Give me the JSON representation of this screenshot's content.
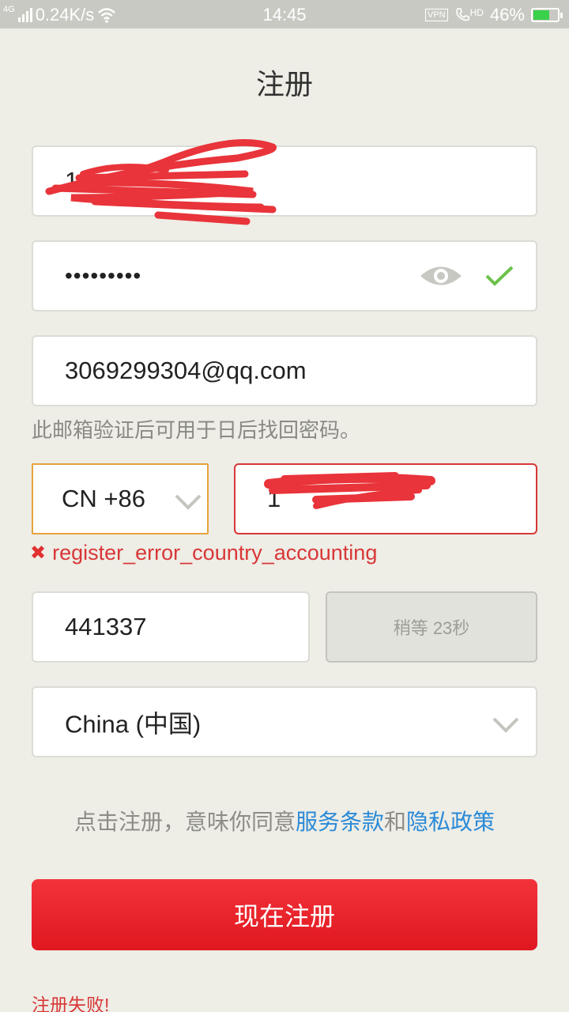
{
  "status_bar": {
    "network_type": "4G",
    "speed": "0.24K/s",
    "time": "14:45",
    "vpn": "VPN",
    "hd": "HD",
    "battery": "46%",
    "battery_level": 0.46,
    "icons": [
      "signal-icon",
      "wifi-icon",
      "vpn-icon",
      "call-hd-icon",
      "battery-icon"
    ]
  },
  "page": {
    "title": "注册"
  },
  "form": {
    "username": {
      "value": "13"
    },
    "password": {
      "value": "•••••••••",
      "valid": true
    },
    "email": {
      "value": "3069299304@qq.com",
      "hint": "此邮箱验证后可用于日后找回密码。"
    },
    "country_code": {
      "value": "CN +86"
    },
    "phone": {
      "value": "1"
    },
    "phone_error": "register_error_country_accounting",
    "verification_code": {
      "value": "441337"
    },
    "resend_button": "稍等 23秒",
    "region": {
      "value": "China (中国)"
    }
  },
  "agreement": {
    "prefix": "点击注册，意味你同意",
    "terms": "服务条款",
    "conjunction": "和",
    "privacy": "隐私政策"
  },
  "submit_button": "现在注册",
  "failure_message": "注册失败!",
  "colors": {
    "accent": "#e0171f",
    "link": "#2a8ad8",
    "error": "#d83737",
    "focus_border": "#e6a23c",
    "valid_check": "#6cc24a"
  }
}
